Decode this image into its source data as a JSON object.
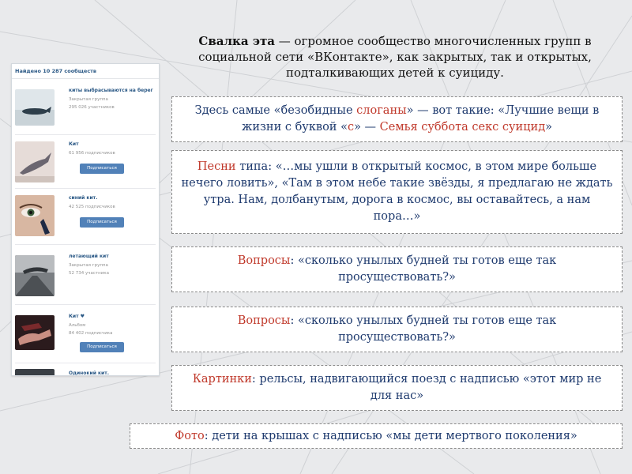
{
  "vk": {
    "found_label": "Найдено 10 287 сообществ",
    "subscribe_label": "Подписаться",
    "items": [
      {
        "name": "киты выбрасываются на берег",
        "type": "Закрытая группа",
        "members": "295 026 участников",
        "has_button": false
      },
      {
        "name": "Кит",
        "type": "",
        "members": "61 956 подписчиков",
        "has_button": true
      },
      {
        "name": "синий кит.",
        "type": "",
        "members": "42 525 подписчиков",
        "has_button": true
      },
      {
        "name": "летающий кит",
        "type": "Закрытая группа",
        "members": "52 734 участника",
        "has_button": false
      },
      {
        "name": "Кит ♥",
        "type": "Альбом",
        "members": "84 402 подписчика",
        "has_button": true
      },
      {
        "name": "Одинокий кит.",
        "type": "",
        "members": "",
        "has_button": false
      }
    ]
  },
  "intro": {
    "bold": "Свалка эта",
    "rest": " — огромное сообщество многочисленных групп в социальной сети «ВКонтакте», как закрытых, так и открытых, подталкивающих детей к суициду."
  },
  "boxes": {
    "slogans": {
      "pre": "Здесь самые «безобидные ",
      "keyword": "слоганы",
      "mid": "» — вот такие: «Лучшие вещи в жизни с буквой «",
      "letter": "с",
      "mid2": "» — ",
      "slogan": "Семья суббота секс суицид",
      "post": "»"
    },
    "songs": {
      "keyword": "Песни",
      "text": " типа: «…мы ушли в открытый космос, в этом мире больше нечего ловить», «Там в этом небе такие звёзды, я предлагаю не ждать утра. Нам, долбанутым, дорога в космос, вы оставайтесь, а нам пора…»"
    },
    "questions1": {
      "keyword": "Вопросы",
      "text": ": «сколько унылых будней ты готов еще так просуществовать?»"
    },
    "questions2": {
      "keyword": "Вопросы",
      "text": ": «сколько унылых будней ты готов еще так просуществовать?»"
    },
    "pictures": {
      "keyword": "Картинки",
      "text": ": рельсы, надвигающийся поезд с надписью «этот мир не для нас»"
    },
    "photo": {
      "keyword": "Фото",
      "text": ": дети на крышах с надписью «мы дети мертвого поколения»"
    }
  },
  "colors": {
    "accent_red": "#c0392b",
    "text_blue": "#1e3a6e",
    "vk_blue": "#5181b8",
    "vk_link": "#2a5885"
  }
}
